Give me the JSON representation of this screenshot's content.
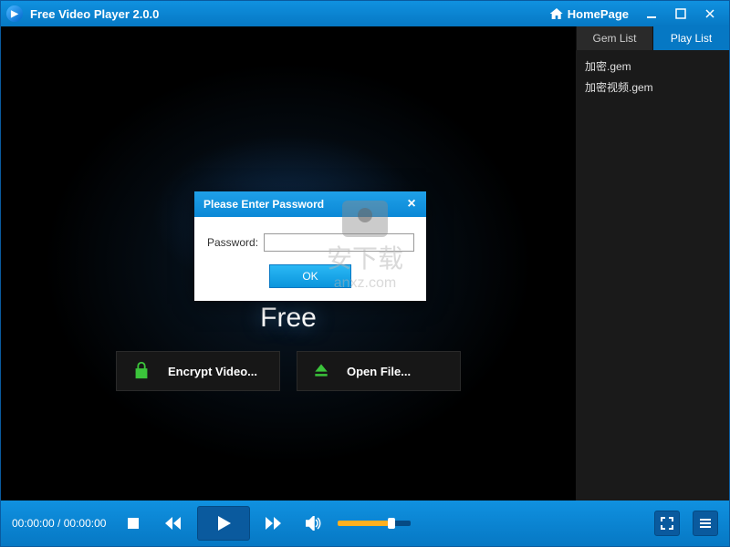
{
  "titlebar": {
    "title": "Free Video Player 2.0.0",
    "homepage_label": "HomePage"
  },
  "video_area": {
    "brand_text": "Free"
  },
  "action_buttons": {
    "encrypt_label": "Encrypt Video...",
    "open_label": "Open File..."
  },
  "sidebar": {
    "tabs": [
      {
        "label": "Gem List"
      },
      {
        "label": "Play List"
      }
    ],
    "items": [
      {
        "label": "加密.gem"
      },
      {
        "label": "加密视频.gem"
      }
    ]
  },
  "playback": {
    "time_current": "00:00:00",
    "time_total": "00:00:00",
    "volume_percent": 70
  },
  "modal": {
    "title": "Please Enter Password",
    "password_label": "Password:",
    "password_value": "",
    "ok_label": "OK"
  },
  "watermark": {
    "text": "安下载",
    "url": "anxz.com"
  }
}
